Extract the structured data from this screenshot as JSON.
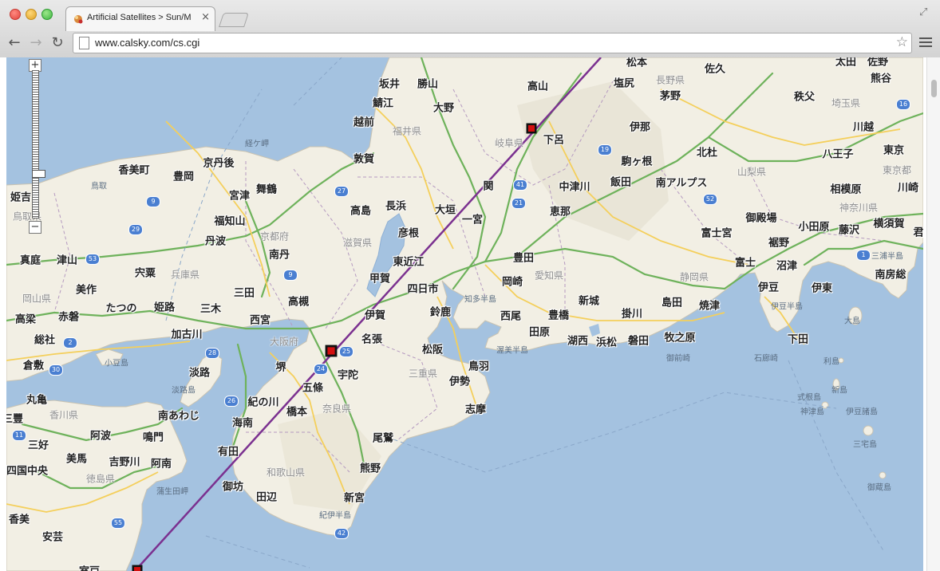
{
  "browser": {
    "tab_title": "Artificial Satellites > Sun/M",
    "tab_close": "×",
    "url": "www.calsky.com/cs.cgi",
    "star": "☆"
  },
  "map": {
    "zoom_in": "+",
    "zoom_out": "−",
    "colors": {
      "sea": "#a4c2e0",
      "land": "#f2efe4",
      "track": "#7b3190",
      "marker": "#d30f0f"
    },
    "cities": [
      {
        "name": "松本"
      },
      {
        "name": "太田"
      },
      {
        "name": "佐野"
      },
      {
        "name": "佐久"
      },
      {
        "name": "熊谷"
      },
      {
        "name": "坂井"
      },
      {
        "name": "勝山"
      },
      {
        "name": "高山"
      },
      {
        "name": "塩尻"
      },
      {
        "name": "鯖江"
      },
      {
        "name": "大野"
      },
      {
        "name": "茅野"
      },
      {
        "name": "秩父"
      },
      {
        "name": "越前"
      },
      {
        "name": "伊那"
      },
      {
        "name": "川越"
      },
      {
        "name": "下呂"
      },
      {
        "name": "北杜"
      },
      {
        "name": "敦賀"
      },
      {
        "name": "駒ヶ根"
      },
      {
        "name": "八王子"
      },
      {
        "name": "東京"
      },
      {
        "name": "香美町"
      },
      {
        "name": "豊岡"
      },
      {
        "name": "京丹後"
      },
      {
        "name": "関"
      },
      {
        "name": "中津川"
      },
      {
        "name": "飯田"
      },
      {
        "name": "南アルプス"
      },
      {
        "name": "宮津"
      },
      {
        "name": "舞鶴"
      },
      {
        "name": "相模原"
      },
      {
        "name": "川崎"
      },
      {
        "name": "高島"
      },
      {
        "name": "長浜"
      },
      {
        "name": "大垣"
      },
      {
        "name": "恵那"
      },
      {
        "name": "一宮"
      },
      {
        "name": "福知山"
      },
      {
        "name": "御殿場"
      },
      {
        "name": "小田原"
      },
      {
        "name": "藤沢"
      },
      {
        "name": "横須賀"
      },
      {
        "name": "彦根"
      },
      {
        "name": "富士宮"
      },
      {
        "name": "丹波"
      },
      {
        "name": "裾野"
      },
      {
        "name": "南丹"
      },
      {
        "name": "東近江"
      },
      {
        "name": "豊田"
      },
      {
        "name": "真庭"
      },
      {
        "name": "津山"
      },
      {
        "name": "富士"
      },
      {
        "name": "沼津"
      },
      {
        "name": "宍粟"
      },
      {
        "name": "甲賀"
      },
      {
        "name": "岡崎"
      },
      {
        "name": "南房総"
      },
      {
        "name": "美作"
      },
      {
        "name": "三田"
      },
      {
        "name": "高槻"
      },
      {
        "name": "四日市"
      },
      {
        "name": "伊豆"
      },
      {
        "name": "伊東"
      },
      {
        "name": "新城"
      },
      {
        "name": "たつの"
      },
      {
        "name": "姫路"
      },
      {
        "name": "三木"
      },
      {
        "name": "伊賀"
      },
      {
        "name": "鈴鹿"
      },
      {
        "name": "島田"
      },
      {
        "name": "焼津"
      },
      {
        "name": "高梁"
      },
      {
        "name": "赤磐"
      },
      {
        "name": "西宮"
      },
      {
        "name": "西尾"
      },
      {
        "name": "豊橋"
      },
      {
        "name": "掛川"
      },
      {
        "name": "加古川"
      },
      {
        "name": "名張"
      },
      {
        "name": "田原"
      },
      {
        "name": "湖西"
      },
      {
        "name": "浜松"
      },
      {
        "name": "磐田"
      },
      {
        "name": "牧之原"
      },
      {
        "name": "総社"
      },
      {
        "name": "下田"
      },
      {
        "name": "松阪"
      },
      {
        "name": "倉敷"
      },
      {
        "name": "鳥羽"
      },
      {
        "name": "堺"
      },
      {
        "name": "淡路"
      },
      {
        "name": "宇陀"
      },
      {
        "name": "伊勢"
      },
      {
        "name": "丸亀"
      },
      {
        "name": "五條"
      },
      {
        "name": "紀の川"
      },
      {
        "name": "志摩"
      },
      {
        "name": "橋本"
      },
      {
        "name": "南あわじ"
      },
      {
        "name": "海南"
      },
      {
        "name": "阿波"
      },
      {
        "name": "鳴門"
      },
      {
        "name": "尾鷲"
      },
      {
        "name": "三好"
      },
      {
        "name": "有田"
      },
      {
        "name": "美馬"
      },
      {
        "name": "吉野川"
      },
      {
        "name": "阿南"
      },
      {
        "name": "熊野"
      },
      {
        "name": "四国中央"
      },
      {
        "name": "御坊"
      },
      {
        "name": "田辺"
      },
      {
        "name": "新宮"
      },
      {
        "name": "香美"
      },
      {
        "name": "安芸"
      },
      {
        "name": "室戸"
      },
      {
        "name": "姫吉"
      },
      {
        "name": "君"
      },
      {
        "name": "三豐"
      }
    ],
    "prefectures": [
      {
        "name": "長野県"
      },
      {
        "name": "埼玉県"
      },
      {
        "name": "福井県"
      },
      {
        "name": "岐阜県"
      },
      {
        "name": "山梨県"
      },
      {
        "name": "東京都"
      },
      {
        "name": "神奈川県"
      },
      {
        "name": "京都府"
      },
      {
        "name": "滋賀県"
      },
      {
        "name": "兵庫県"
      },
      {
        "name": "愛知県"
      },
      {
        "name": "静岡県"
      },
      {
        "name": "岡山県"
      },
      {
        "name": "大阪府"
      },
      {
        "name": "三重県"
      },
      {
        "name": "奈良県"
      },
      {
        "name": "香川県"
      },
      {
        "name": "和歌山県"
      },
      {
        "name": "徳島県"
      },
      {
        "name": "鳥取県"
      }
    ],
    "minor_labels": [
      {
        "name": "経ケ岬"
      },
      {
        "name": "鳥取"
      },
      {
        "name": "知多半島"
      },
      {
        "name": "渥美半島"
      },
      {
        "name": "伊豆半島"
      },
      {
        "name": "御前崎"
      },
      {
        "name": "石廊崎"
      },
      {
        "name": "大島"
      },
      {
        "name": "利島"
      },
      {
        "name": "新島"
      },
      {
        "name": "式根島"
      },
      {
        "name": "神津島"
      },
      {
        "name": "伊豆諸島"
      },
      {
        "name": "三宅島"
      },
      {
        "name": "御蔵島"
      },
      {
        "name": "小豆島"
      },
      {
        "name": "淡路島"
      },
      {
        "name": "蒲生田岬"
      },
      {
        "name": "紀伊半島"
      },
      {
        "name": "三浦半島"
      }
    ],
    "routes": [
      {
        "no": "16"
      },
      {
        "no": "19"
      },
      {
        "no": "41"
      },
      {
        "no": "21"
      },
      {
        "no": "52"
      },
      {
        "no": "27"
      },
      {
        "no": "9"
      },
      {
        "no": "29"
      },
      {
        "no": "53"
      },
      {
        "no": "9"
      },
      {
        "no": "2"
      },
      {
        "no": "25"
      },
      {
        "no": "24"
      },
      {
        "no": "28"
      },
      {
        "no": "30"
      },
      {
        "no": "26"
      },
      {
        "no": "55"
      },
      {
        "no": "42"
      },
      {
        "no": "11"
      },
      {
        "no": "1"
      }
    ]
  }
}
